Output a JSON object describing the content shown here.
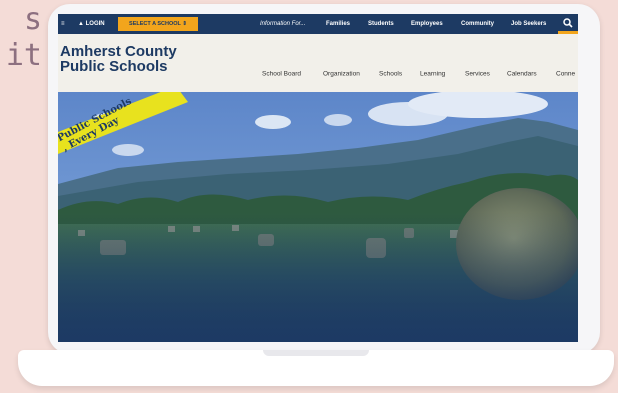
{
  "side_text": [
    "s",
    "it"
  ],
  "topbar": {
    "hash": "≡",
    "login": "LOGIN",
    "select_school": "SELECT A SCHOOL",
    "info_for": "Information For...",
    "links": [
      "Families",
      "Students",
      "Employees",
      "Community",
      "Job Seekers"
    ]
  },
  "header": {
    "logo_line1": "Amherst County",
    "logo_line2": "Public Schools",
    "nav": [
      "School Board",
      "Organization",
      "Schools",
      "Learning",
      "Services",
      "Calendars",
      "Conne"
    ]
  },
  "hero": {
    "banner_line1": "Public Schools",
    "banner_line2": ", Every Day"
  },
  "colors": {
    "navy": "#1d3a63",
    "accent": "#f2a51c",
    "banner": "#e8e21e",
    "background": "#f4dcd7"
  }
}
